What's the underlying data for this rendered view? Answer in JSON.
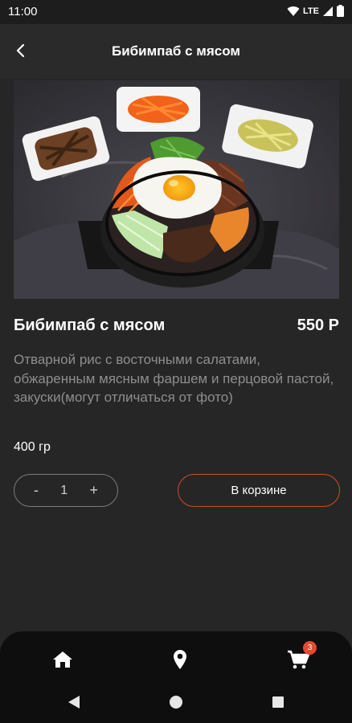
{
  "status_bar": {
    "time": "11:00",
    "network": "LTE"
  },
  "header": {
    "title": "Бибимпаб с мясом"
  },
  "product": {
    "name": "Бибимпаб с мясом",
    "price": "550 Р",
    "description": "Отварной рис с восточными салатами, обжаренным мясным фаршем и перцовой пастой, закуски(могут отличаться от фото)",
    "weight": "400 гр",
    "quantity": "1"
  },
  "stepper": {
    "minus": "-",
    "plus": "+"
  },
  "actions": {
    "cart_label": "В корзине"
  },
  "bottom_nav": {
    "cart_badge": "3"
  },
  "colors": {
    "accent": "#d04b2b",
    "badge": "#e54a2e",
    "background": "#262626"
  }
}
